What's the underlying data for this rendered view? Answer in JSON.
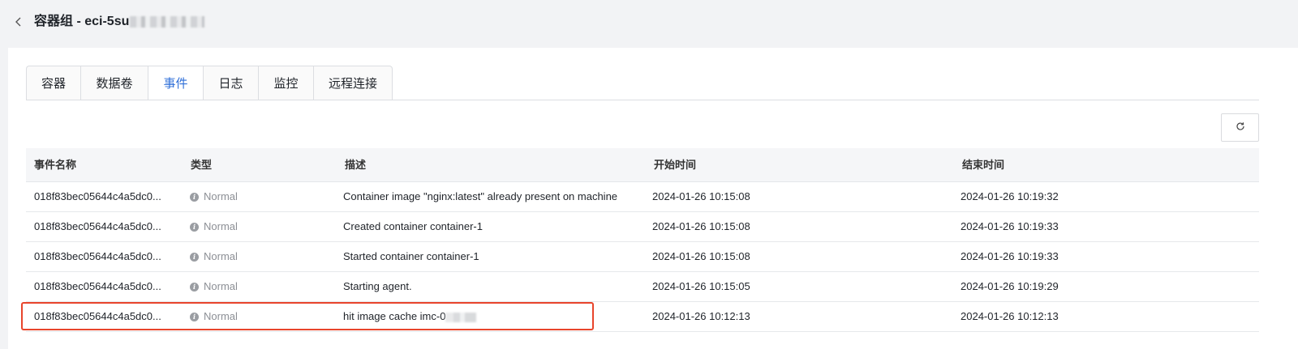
{
  "header": {
    "title": "容器组 - eci-5su"
  },
  "tabs": [
    {
      "label": "容器",
      "active": false
    },
    {
      "label": "数据卷",
      "active": false
    },
    {
      "label": "事件",
      "active": true
    },
    {
      "label": "日志",
      "active": false
    },
    {
      "label": "监控",
      "active": false
    },
    {
      "label": "远程连接",
      "active": false
    }
  ],
  "toolbar": {
    "refresh_icon": "refresh-icon"
  },
  "colors": {
    "accent": "#2f6fd8",
    "highlight_border": "#e8452c",
    "muted_text": "#8c8f95"
  },
  "table": {
    "columns": [
      "事件名称",
      "类型",
      "描述",
      "开始时间",
      "结束时间"
    ],
    "rows": [
      {
        "name": "018f83bec05644c4a5dc0...",
        "type": "Normal",
        "description": "Container image \"nginx:latest\" already present on machine",
        "start": "2024-01-26 10:15:08",
        "end": "2024-01-26 10:19:32"
      },
      {
        "name": "018f83bec05644c4a5dc0...",
        "type": "Normal",
        "description": "Created container container-1",
        "start": "2024-01-26 10:15:08",
        "end": "2024-01-26 10:19:33"
      },
      {
        "name": "018f83bec05644c4a5dc0...",
        "type": "Normal",
        "description": "Started container container-1",
        "start": "2024-01-26 10:15:08",
        "end": "2024-01-26 10:19:33"
      },
      {
        "name": "018f83bec05644c4a5dc0...",
        "type": "Normal",
        "description": "Starting agent.",
        "start": "2024-01-26 10:15:05",
        "end": "2024-01-26 10:19:29"
      },
      {
        "name": "018f83bec05644c4a5dc0...",
        "type": "Normal",
        "description": "hit image cache imc-0",
        "start": "2024-01-26 10:12:13",
        "end": "2024-01-26 10:12:13",
        "highlighted": true
      }
    ]
  }
}
